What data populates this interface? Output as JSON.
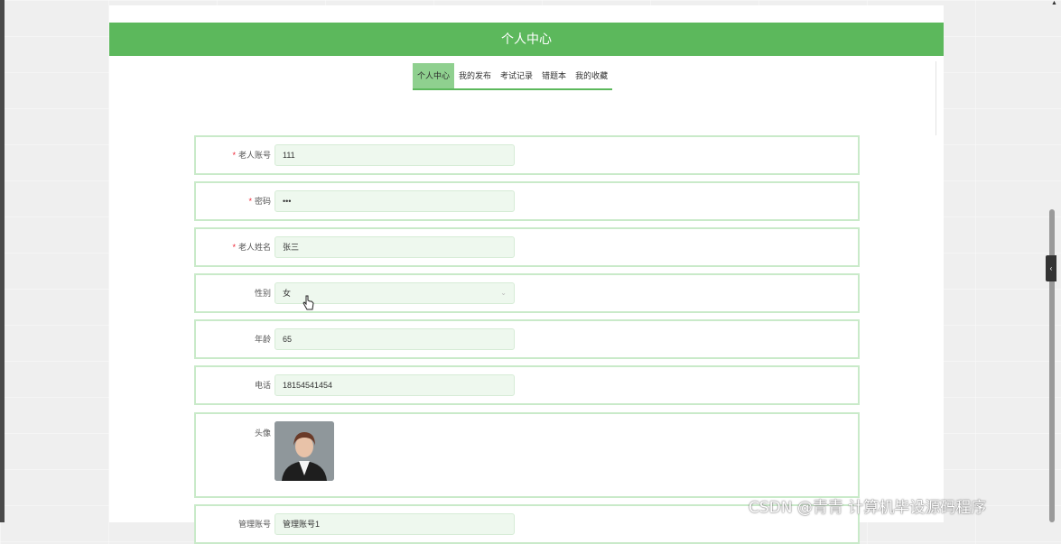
{
  "header": {
    "title": "个人中心"
  },
  "tabs": [
    {
      "label": "个人中心"
    },
    {
      "label": "我的发布"
    },
    {
      "label": "考试记录"
    },
    {
      "label": "错题本"
    },
    {
      "label": "我的收藏"
    }
  ],
  "form": {
    "account": {
      "label": "老人账号",
      "value": "111",
      "required": true
    },
    "password": {
      "label": "密码",
      "value": "•••",
      "required": true
    },
    "name": {
      "label": "老人姓名",
      "value": "张三",
      "required": true
    },
    "gender": {
      "label": "性别",
      "value": "女"
    },
    "age": {
      "label": "年龄",
      "value": "65"
    },
    "phone": {
      "label": "电话",
      "value": "18154541454"
    },
    "avatar": {
      "label": "头像"
    },
    "partial": {
      "label": "管理账号",
      "value": "管理账号1"
    }
  },
  "required_mark": "*",
  "watermark": "CSDN @青青  计算机毕设源码程序",
  "colors": {
    "accent": "#5cb85c",
    "field_bg": "#eef8ee",
    "field_border": "#c9eac9"
  }
}
